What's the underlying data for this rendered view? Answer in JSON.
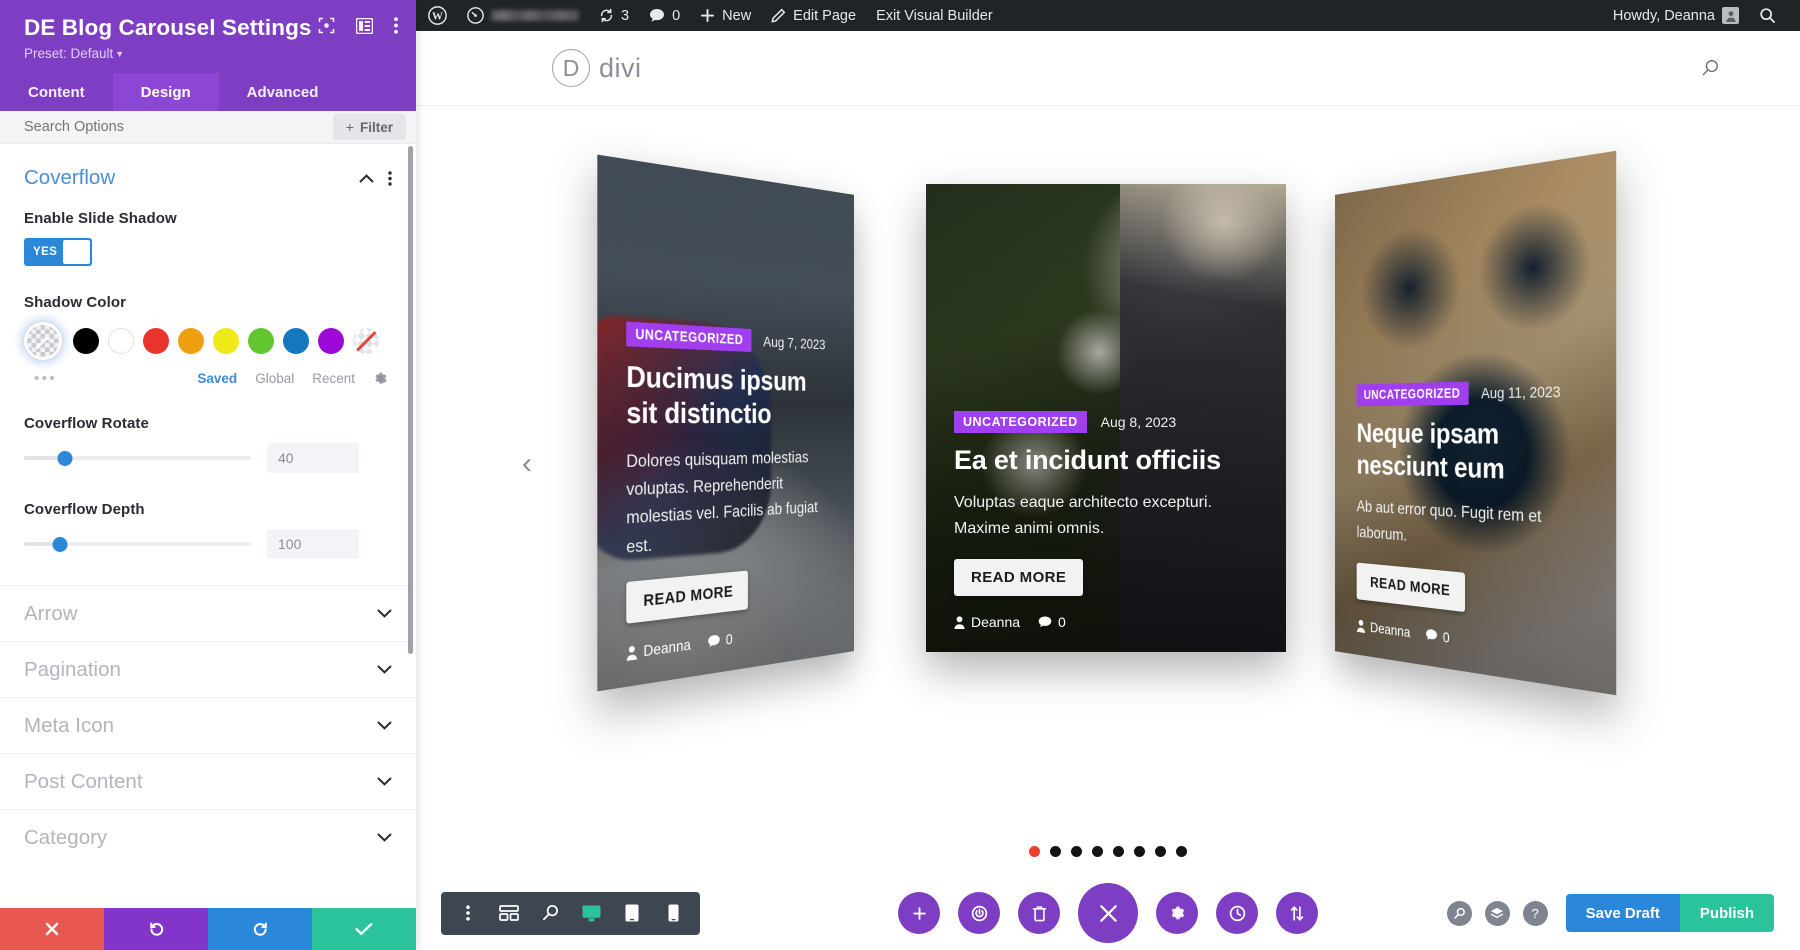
{
  "settings_panel": {
    "title": "DE Blog Carousel Settings",
    "preset_label": "Preset: Default",
    "header_icons": [
      {
        "name": "focus-target-icon"
      },
      {
        "name": "layout-panel-icon"
      },
      {
        "name": "more-vertical-icon"
      }
    ],
    "tabs": [
      {
        "label": "Content",
        "active": false
      },
      {
        "label": "Design",
        "active": true
      },
      {
        "label": "Advanced",
        "active": false
      }
    ],
    "search": {
      "placeholder": "Search Options",
      "value": ""
    },
    "filter_button": {
      "label": "Filter",
      "plus": "+"
    },
    "open_section": {
      "title": "Coverflow",
      "fields": {
        "enable_shadow": {
          "label": "Enable Slide Shadow",
          "toggle_value": "YES"
        },
        "shadow_color": {
          "label": "Shadow Color",
          "selected_name": "custom-color-picker",
          "swatches": [
            {
              "name": "black",
              "hex": "#000000"
            },
            {
              "name": "white",
              "hex": "#ffffff"
            },
            {
              "name": "red",
              "hex": "#e8342a"
            },
            {
              "name": "orange",
              "hex": "#eea010"
            },
            {
              "name": "yellow",
              "hex": "#efe91a"
            },
            {
              "name": "green",
              "hex": "#62c72e"
            },
            {
              "name": "blue",
              "hex": "#1577bd"
            },
            {
              "name": "purple",
              "hex": "#9c09d6"
            },
            {
              "name": "transparent",
              "hex": "transparent"
            }
          ],
          "more_dots": "•••",
          "tabs": [
            {
              "label": "Saved",
              "active": true
            },
            {
              "label": "Global",
              "active": false
            },
            {
              "label": "Recent",
              "active": false
            }
          ]
        },
        "coverflow_rotate": {
          "label": "Coverflow Rotate",
          "value": "40",
          "slider_percent": 18
        },
        "coverflow_depth": {
          "label": "Coverflow Depth",
          "value": "100",
          "slider_percent": 16
        }
      }
    },
    "collapsed_sections": [
      {
        "label": "Arrow"
      },
      {
        "label": "Pagination"
      },
      {
        "label": "Meta Icon"
      },
      {
        "label": "Post Content"
      },
      {
        "label": "Category"
      }
    ],
    "action_buttons": [
      {
        "name": "cancel-button",
        "glyph": "✖",
        "color": "#e8584f"
      },
      {
        "name": "undo-button",
        "glyph": "↺",
        "color": "#8334c9"
      },
      {
        "name": "redo-button",
        "glyph": "↻",
        "color": "#2b87da"
      },
      {
        "name": "save-button",
        "glyph": "✔",
        "color": "#2bc39b"
      }
    ]
  },
  "wp_admin_bar": {
    "items": [
      {
        "name": "wordpress-logo-icon",
        "label": ""
      },
      {
        "name": "site-name",
        "label": ""
      },
      {
        "name": "updates",
        "label": "3"
      },
      {
        "name": "comments",
        "label": "0"
      },
      {
        "name": "new-content",
        "label": "New"
      },
      {
        "name": "edit-page",
        "label": "Edit Page"
      },
      {
        "name": "exit-visual-builder",
        "label": "Exit Visual Builder"
      }
    ],
    "greeting": "Howdy, Deanna"
  },
  "page_header": {
    "logo_letter": "D",
    "logo_word": "divi",
    "search_icon": "search-icon"
  },
  "carousel": {
    "prev_arrow": "‹",
    "next_arrow": "›",
    "dots_total": 8,
    "dots_active_index": 0,
    "slides": [
      {
        "position": "left",
        "category": "UNCATEGORIZED",
        "date": "Aug 7, 2023",
        "title": "Ducimus ipsum sit distinctio",
        "excerpt": "Dolores quisquam molestias voluptas. Reprehenderit molestias vel. Facilis ab fugiat est.",
        "button": "READ MORE",
        "author": "Deanna",
        "comments": "0",
        "image_alt": "snowmobile-mountain-photo"
      },
      {
        "position": "center",
        "category": "UNCATEGORIZED",
        "date": "Aug 8, 2023",
        "title": "Ea et incidunt officiis",
        "excerpt": "Voluptas eaque architecto excepturi. Maxime animi omnis.",
        "button": "READ MORE",
        "author": "Deanna",
        "comments": "0",
        "image_alt": "woman-in-garden-photo"
      },
      {
        "position": "right",
        "category": "UNCATEGORIZED",
        "date": "Aug 11, 2023",
        "title": "Neque ipsam nesciunt eum",
        "excerpt": "Ab aut error quo. Fugit rem et laborum.",
        "button": "READ MORE",
        "author": "Deanna",
        "comments": "0",
        "image_alt": "dog-closeup-photo"
      }
    ]
  },
  "builder_bar": {
    "left_tools": [
      {
        "name": "more-vertical-icon",
        "active": false
      },
      {
        "name": "wireframe-view-icon",
        "active": false
      },
      {
        "name": "zoom-out-view-icon",
        "active": false
      },
      {
        "name": "desktop-view-icon",
        "active": true
      },
      {
        "name": "tablet-view-icon",
        "active": false
      },
      {
        "name": "phone-view-icon",
        "active": false
      }
    ],
    "center_tools": [
      {
        "name": "add-section-button",
        "glyph": "+"
      },
      {
        "name": "toggle-power-button",
        "glyph": "⏻"
      },
      {
        "name": "trash-button",
        "glyph": "🗑"
      },
      {
        "name": "close-builder-button",
        "glyph": "✕",
        "big": true
      },
      {
        "name": "settings-gear-button",
        "glyph": "✷"
      },
      {
        "name": "history-clock-button",
        "glyph": "◕"
      },
      {
        "name": "sort-updown-button",
        "glyph": "↕"
      }
    ],
    "right_tools": [
      {
        "name": "search-icon",
        "glyph": "⚲"
      },
      {
        "name": "layers-icon",
        "glyph": "◈"
      },
      {
        "name": "help-icon",
        "glyph": "?"
      }
    ],
    "save_draft_label": "Save Draft",
    "publish_label": "Publish"
  },
  "colors": {
    "panel_purple": "#7d3ec4",
    "tab_active_purple": "#8b46d6",
    "accent_blue": "#2b87da",
    "accent_green": "#2bc39b",
    "category_purple": "#a13ef0",
    "active_dot_red": "#e8402a",
    "admin_bar": "#1f2427"
  }
}
